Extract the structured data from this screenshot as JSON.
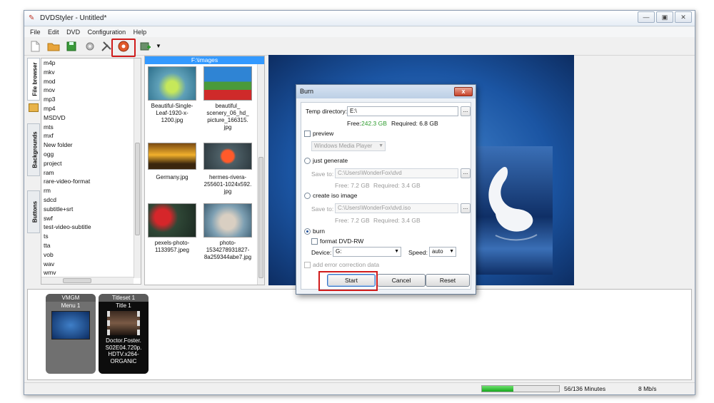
{
  "window": {
    "title": "DVDStyler - Untitled*",
    "min": "—",
    "max": "▣",
    "close": "✕"
  },
  "menu": [
    "File",
    "Edit",
    "DVD",
    "Configuration",
    "Help"
  ],
  "side_tabs": [
    "File browser",
    "Backgrounds",
    "Buttons"
  ],
  "file_list": [
    "m4p",
    "mkv",
    "mod",
    "mov",
    "mp3",
    "mp4",
    "MSDVD",
    "mts",
    "mxf",
    "New folder",
    "ogg",
    "project",
    "ram",
    "rare-video-format",
    "rm",
    "sdcd",
    "subtitle+srt",
    "swf",
    "test-video-subtitle",
    "ts",
    "tta",
    "vob",
    "wav",
    "wmv"
  ],
  "gallery": {
    "path": "F:\\images",
    "items": [
      {
        "name": "Beautiful-Single-\nLeaf-1920-x-\n1200.jpg"
      },
      {
        "name": "beautiful_\nscenery_06_hd_\npicture_166315.\njpg"
      },
      {
        "name": "Germany.jpg"
      },
      {
        "name": "hermes-rivera-\n255601-1024x592.\njpg"
      },
      {
        "name": "pexels-photo-\n1133957.jpeg"
      },
      {
        "name": "photo-\n1534278931827-\n8a259344abe7.jpg"
      }
    ]
  },
  "burn_dialog": {
    "title": "Burn",
    "close": "x",
    "temp_dir_label": "Temp directory:",
    "temp_dir_value": "E:\\",
    "free_label": "Free:",
    "free_value": "242.3 GB",
    "required_label": "Required: 6.8 GB",
    "preview_label": "preview",
    "player_value": "Windows Media Player",
    "just_generate_label": "just generate",
    "save_to_label": "Save to:",
    "save_to_dvd": "C:\\Users\\WonderFox\\dvd",
    "gen_free": "Free: 7.2 GB",
    "gen_required": "Required: 3.4 GB",
    "iso_label": "create iso image",
    "save_to_iso": "C:\\Users\\WonderFox\\dvd.iso",
    "iso_free": "Free: 7.2 GB",
    "iso_required": "Required: 3.4 GB",
    "burn_label": "burn",
    "format_label": "format DVD-RW",
    "device_label": "Device:",
    "device_value": "G:",
    "speed_label": "Speed:",
    "speed_value": "auto",
    "ecc_label": "add error correction data",
    "start": "Start",
    "cancel": "Cancel",
    "reset": "Reset",
    "browse": "..."
  },
  "titleset": {
    "vmgm": "VMGM",
    "menu1": "Menu 1",
    "titleset1": "Titleset 1",
    "title1": "Title 1",
    "clip": "Doctor.Foster.\nS02E04.720p.\nHDTV.x264-\nORGANiC"
  },
  "status": {
    "minutes": "56/136 Minutes",
    "rate": "8 Mb/s",
    "progress": 0.41
  },
  "colors": {
    "accent": "#3399ff",
    "highlight": "#d01c1c",
    "free_green": "#2e9b2e"
  }
}
